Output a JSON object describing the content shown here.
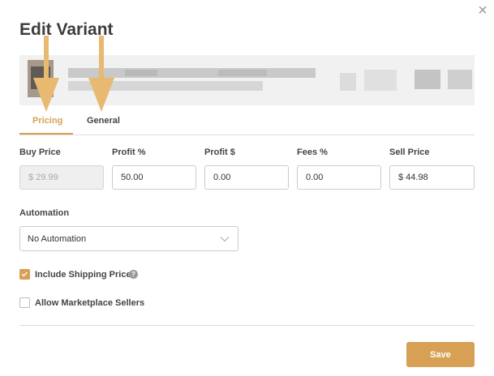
{
  "dialog": {
    "title": "Edit Variant",
    "close_icon": "close-icon"
  },
  "tabs": [
    {
      "label": "Pricing",
      "active": true
    },
    {
      "label": "General",
      "active": false
    }
  ],
  "pricing": {
    "buy_price": {
      "label": "Buy Price",
      "value": "$ 29.99",
      "disabled": true
    },
    "profit_pct": {
      "label": "Profit %",
      "value": "50.00"
    },
    "profit_usd": {
      "label": "Profit $",
      "value": "0.00"
    },
    "fees_pct": {
      "label": "Fees %",
      "value": "0.00"
    },
    "sell_price": {
      "label": "Sell Price",
      "value": "$ 44.98"
    }
  },
  "automation": {
    "label": "Automation",
    "selected": "No Automation"
  },
  "options": {
    "include_shipping": {
      "label": "Include Shipping Price",
      "checked": true
    },
    "allow_marketplace": {
      "label": "Allow Marketplace Sellers",
      "checked": false
    },
    "help_icon": "?"
  },
  "footer": {
    "save_label": "Save"
  },
  "colors": {
    "accent": "#d8a054",
    "annotation_arrow": "#e8b970"
  }
}
